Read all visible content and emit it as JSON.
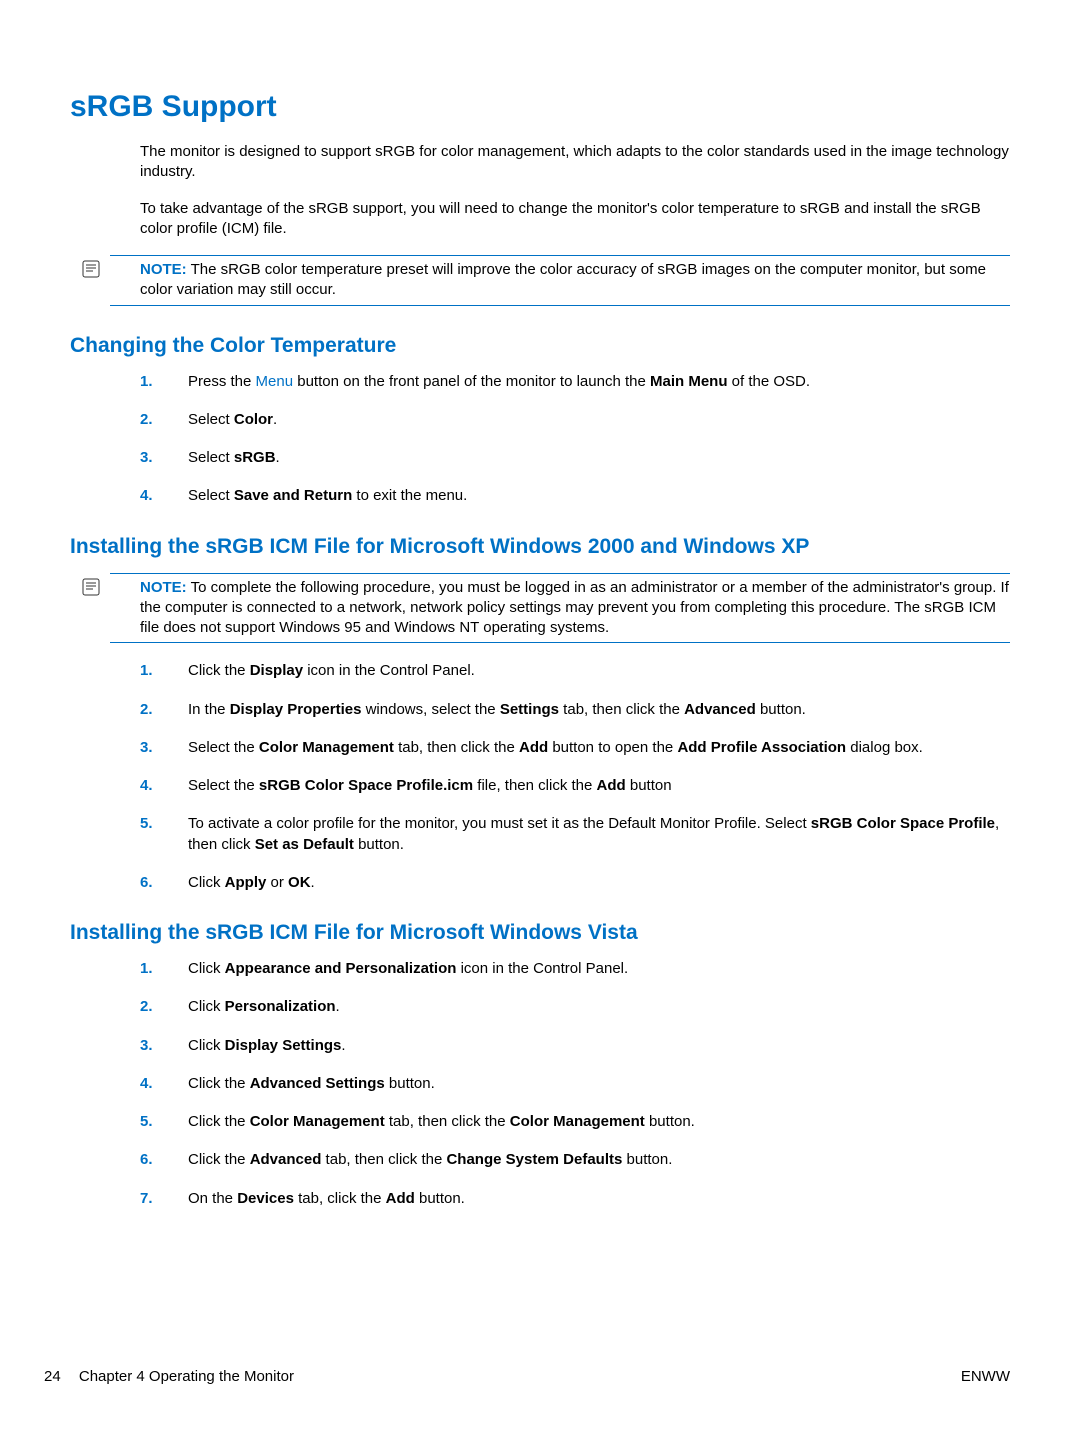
{
  "title": "sRGB Support",
  "intro_p1": "The monitor is designed to support sRGB for color management, which adapts to the color standards used in the image technology industry.",
  "intro_p2": "To take advantage of the sRGB support, you will need to change the monitor's color temperature to sRGB and install the sRGB color profile (ICM) file.",
  "note1_label": "NOTE:",
  "note1_text": "The sRGB color temperature preset will improve the color accuracy of sRGB images on the computer monitor, but some color variation may still occur.",
  "section1_title": "Changing the Color Temperature",
  "s1_step1_a": "Press the ",
  "s1_step1_link": "Menu",
  "s1_step1_b": " button on the front panel of the monitor to launch the ",
  "s1_step1_bold": "Main Menu",
  "s1_step1_c": " of the OSD.",
  "s1_step2_a": "Select ",
  "s1_step2_bold": "Color",
  "s1_step2_b": ".",
  "s1_step3_a": "Select ",
  "s1_step3_bold": "sRGB",
  "s1_step3_b": ".",
  "s1_step4_a": "Select ",
  "s1_step4_bold": "Save and Return",
  "s1_step4_b": " to exit the menu.",
  "section2_title": "Installing the sRGB ICM File for Microsoft Windows 2000 and Windows XP",
  "note2_label": "NOTE:",
  "note2_text": "To complete the following procedure, you must be logged in as an administrator or a member of the administrator's group. If the computer is connected to a network, network policy settings may prevent you from completing this procedure. The sRGB ICM file does not support Windows 95 and Windows NT operating systems.",
  "s2_step1_a": "Click the ",
  "s2_step1_bold": "Display",
  "s2_step1_b": " icon in the Control Panel.",
  "s2_step2_a": "In the ",
  "s2_step2_b1": "Display Properties",
  "s2_step2_c": " windows, select the ",
  "s2_step2_b2": "Settings",
  "s2_step2_d": " tab, then click the ",
  "s2_step2_b3": "Advanced",
  "s2_step2_e": " button.",
  "s2_step3_a": "Select the ",
  "s2_step3_b1": "Color Management",
  "s2_step3_c": " tab, then click the ",
  "s2_step3_b2": "Add",
  "s2_step3_d": " button to open the ",
  "s2_step3_b3": "Add Profile Association",
  "s2_step3_e": " dialog box.",
  "s2_step4_a": "Select the ",
  "s2_step4_b1": "sRGB Color Space Profile.icm",
  "s2_step4_c": " file, then click the ",
  "s2_step4_b2": "Add",
  "s2_step4_d": " button",
  "s2_step5_a": "To activate a color profile for the monitor, you must set it as the Default Monitor Profile. Select ",
  "s2_step5_b1": "sRGB Color Space Profile",
  "s2_step5_c": ", then click ",
  "s2_step5_b2": "Set as Default",
  "s2_step5_d": " button.",
  "s2_step6_a": "Click ",
  "s2_step6_b1": "Apply",
  "s2_step6_c": " or ",
  "s2_step6_b2": "OK",
  "s2_step6_d": ".",
  "section3_title": "Installing the sRGB ICM File for Microsoft Windows Vista",
  "s3_step1_a": "Click ",
  "s3_step1_b1": "Appearance and Personalization",
  "s3_step1_c": " icon in the Control Panel.",
  "s3_step2_a": "Click ",
  "s3_step2_b1": "Personalization",
  "s3_step2_c": ".",
  "s3_step3_a": "Click ",
  "s3_step3_b1": "Display Settings",
  "s3_step3_c": ".",
  "s3_step4_a": "Click the ",
  "s3_step4_b1": "Advanced Settings",
  "s3_step4_c": " button.",
  "s3_step5_a": "Click the ",
  "s3_step5_b1": "Color Management",
  "s3_step5_c": " tab, then click the ",
  "s3_step5_b2": "Color Management",
  "s3_step5_d": " button.",
  "s3_step6_a": "Click the ",
  "s3_step6_b1": "Advanced",
  "s3_step6_c": " tab, then click the ",
  "s3_step6_b2": "Change System Defaults",
  "s3_step6_d": " button.",
  "s3_step7_a": "On the ",
  "s3_step7_b1": "Devices",
  "s3_step7_c": " tab, click the ",
  "s3_step7_b2": "Add",
  "s3_step7_d": " button.",
  "footer_page": "24",
  "footer_chapter": "Chapter 4   Operating the Monitor",
  "footer_right": "ENWW"
}
